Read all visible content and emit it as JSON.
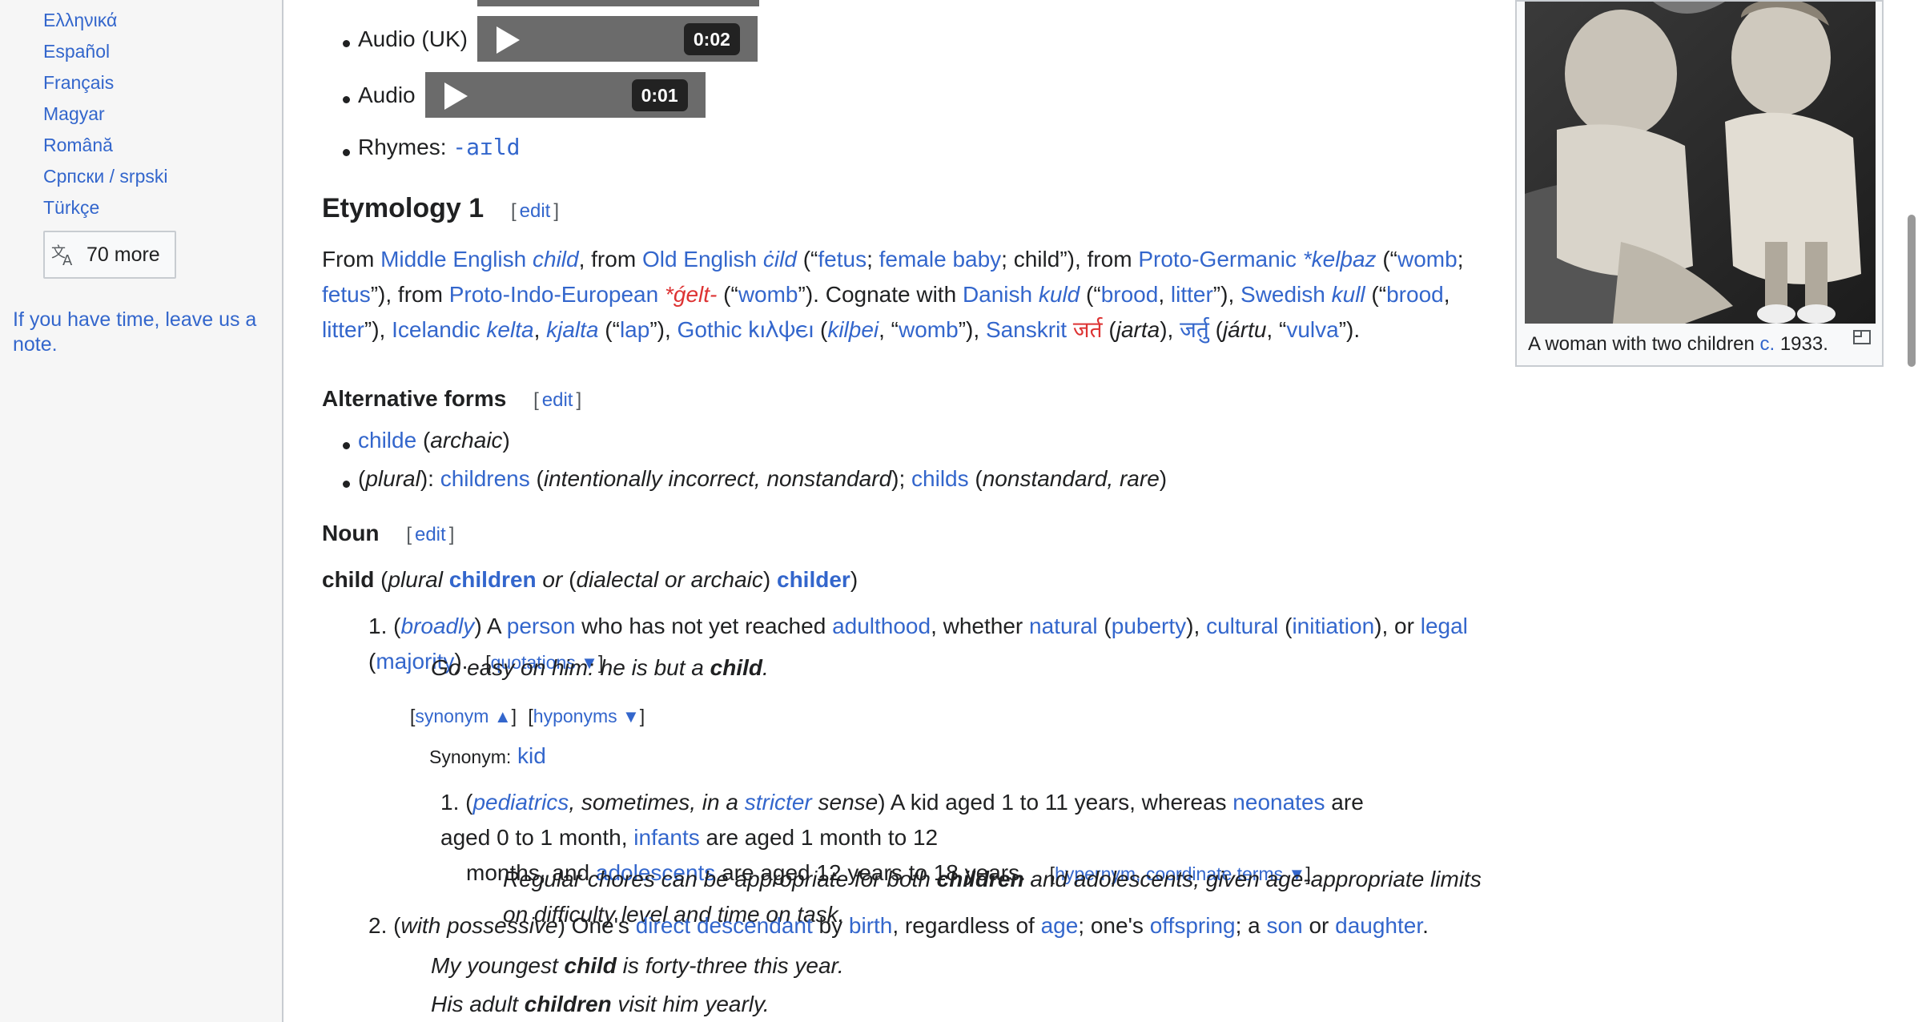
{
  "sidebar": {
    "languages": [
      "Ελληνικά",
      "Español",
      "Français",
      "Magyar",
      "Română",
      "Српски / srpski",
      "Türkçe"
    ],
    "more_label": "70 more",
    "note": "If you have time, leave us a note."
  },
  "pronunciation": {
    "audio_uk_label": "Audio (UK)",
    "audio_uk_time": "0:02",
    "audio_label": "Audio",
    "audio_time": "0:01",
    "rhymes_label": "Rhymes:",
    "rhymes_value": "-aɪld"
  },
  "etymology": {
    "heading": "Etymology 1",
    "edit": "edit"
  },
  "alt_forms": {
    "heading": "Alternative forms",
    "edit": "edit"
  },
  "noun": {
    "heading": "Noun",
    "edit": "edit",
    "headword": "child",
    "plural_word": "children",
    "dialectal_word": "childer"
  },
  "sense1": {
    "quotations_label": "quotations",
    "example": "Go easy on him: he is but a",
    "example_bold": "child",
    "synonym_toggle": "synonym",
    "hyponyms_toggle": "hyponyms",
    "synonym_label": "Synonym:",
    "synonym_value": "kid",
    "sub_hypernym_toggle": "hypernym, coordinate terms"
  },
  "thumb": {
    "caption_pre": "A woman with two children",
    "caption_link": "c.",
    "caption_post": "1933."
  }
}
